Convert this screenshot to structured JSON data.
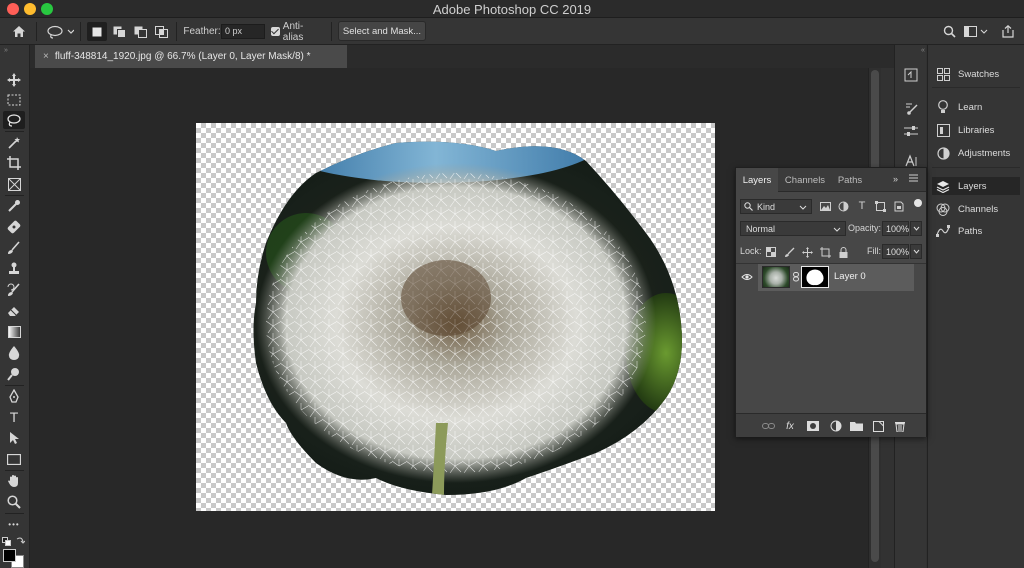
{
  "window": {
    "title": "Adobe Photoshop CC 2019"
  },
  "options_bar": {
    "feather_label": "Feather:",
    "feather_value": "0 px",
    "antialias_label": "Anti-alias",
    "select_and_mask_label": "Select and Mask..."
  },
  "document": {
    "tab_title": "fluff-348814_1920.jpg @ 66.7% (Layer 0, Layer Mask/8) *",
    "close_glyph": "×"
  },
  "toolbar": {
    "tools": [
      "move",
      "rectangular-marquee",
      "lasso",
      "magic-wand",
      "crop",
      "frame",
      "eyedropper",
      "spot-healing-brush",
      "brush",
      "clone-stamp",
      "history-brush",
      "eraser",
      "gradient",
      "blur",
      "dodge",
      "pen",
      "type",
      "path-selection",
      "rectangle",
      "hand",
      "zoom",
      "edit-toolbar"
    ],
    "active_tool": "lasso",
    "type_glyph": "T",
    "more_glyph": "•••"
  },
  "right_panel": {
    "items": [
      {
        "label": "Swatches",
        "icon": "swatches-icon"
      },
      {
        "label": "Learn",
        "icon": "lightbulb-icon"
      },
      {
        "label": "Libraries",
        "icon": "libraries-icon"
      },
      {
        "label": "Adjustments",
        "icon": "adjustments-icon"
      },
      {
        "label": "Layers",
        "icon": "layers-icon"
      },
      {
        "label": "Channels",
        "icon": "channels-icon"
      },
      {
        "label": "Paths",
        "icon": "paths-icon"
      }
    ],
    "active": "Layers"
  },
  "layers_panel": {
    "tabs": [
      "Layers",
      "Channels",
      "Paths"
    ],
    "active_tab": "Layers",
    "kind_label": "Kind",
    "blend_mode": "Normal",
    "opacity_label": "Opacity:",
    "opacity_value": "100%",
    "lock_label": "Lock:",
    "fill_label": "Fill:",
    "fill_value": "100%",
    "layers": [
      {
        "name": "Layer 0",
        "visible": true,
        "has_mask": true
      }
    ]
  },
  "colors": {
    "app_bg": "#323232",
    "panel_bg": "#474747",
    "workspace_bg": "#282828",
    "selected_layer": "#5c5c5c"
  }
}
